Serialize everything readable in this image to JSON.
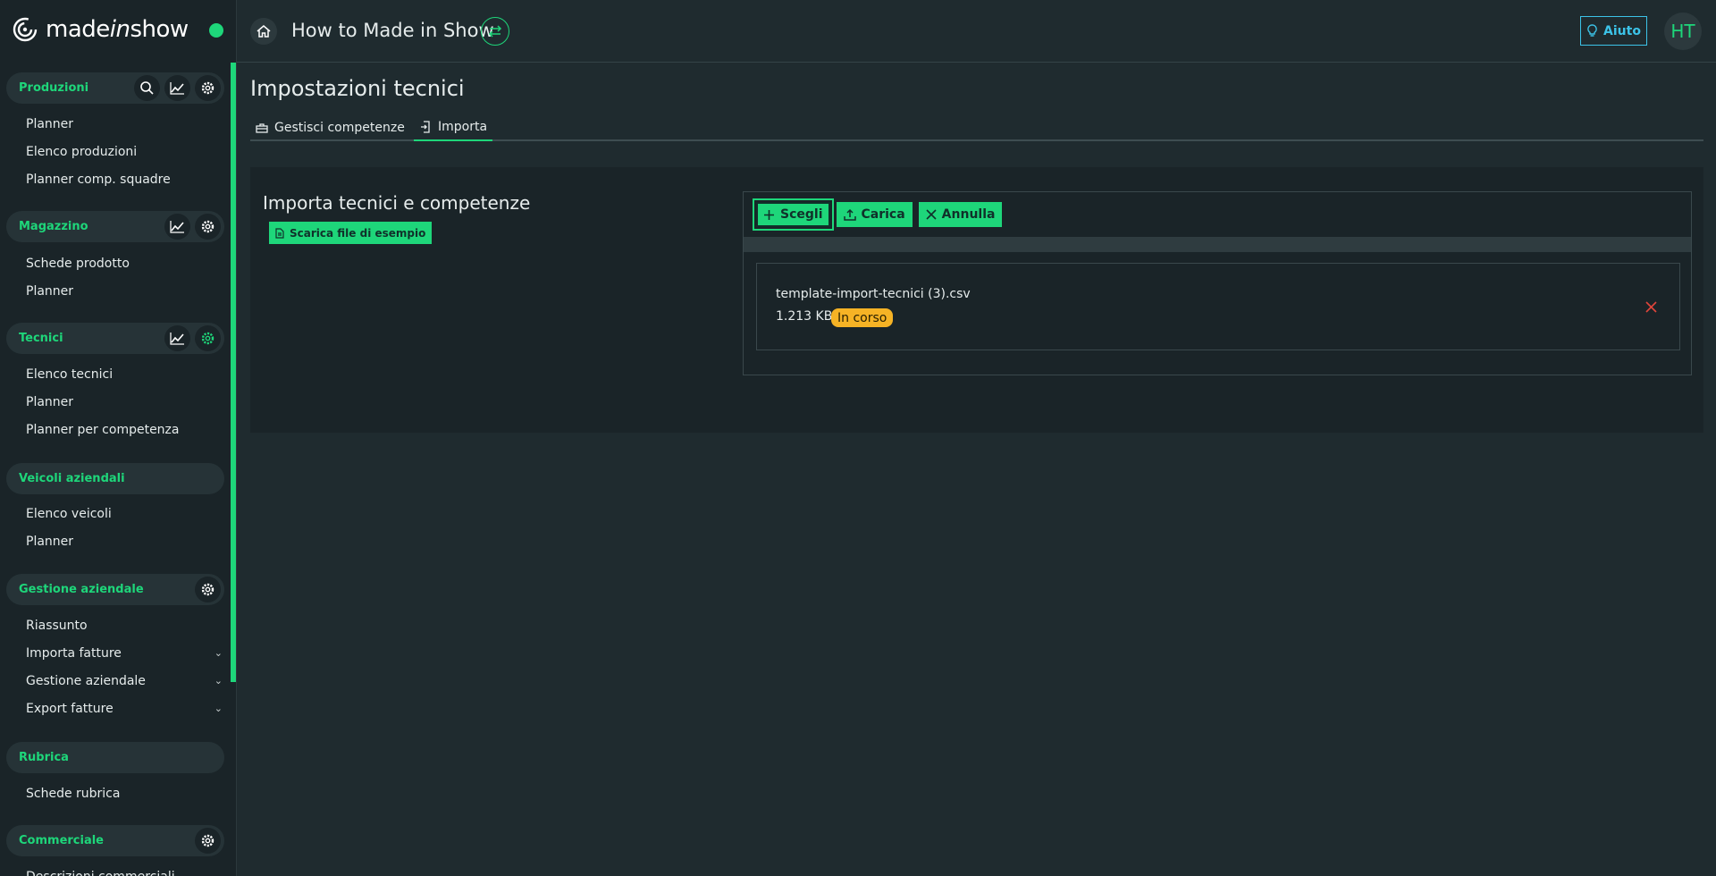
{
  "brand": {
    "name_pre": "made",
    "name_it": "in",
    "name_post": "show"
  },
  "sidebar": {
    "sections": [
      {
        "title": "Produzioni",
        "icons": [
          "search-icon",
          "chart-icon",
          "gear-icon"
        ],
        "items": [
          "Planner",
          "Elenco produzioni",
          "Planner comp. squadre"
        ]
      },
      {
        "title": "Magazzino",
        "icons": [
          "chart-icon",
          "gear-icon"
        ],
        "items": [
          "Schede prodotto",
          "Planner"
        ]
      },
      {
        "title": "Tecnici",
        "icons": [
          "chart-icon",
          "gear-icon"
        ],
        "items": [
          "Elenco tecnici",
          "Planner",
          "Planner per competenza"
        ]
      },
      {
        "title": "Veicoli aziendali",
        "icons": [],
        "items": [
          "Elenco veicoli",
          "Planner"
        ]
      },
      {
        "title": "Gestione aziendale",
        "icons": [
          "gear-icon"
        ],
        "items": [
          "Riassunto",
          "Importa fatture",
          "Gestione aziendale",
          "Export fatture"
        ]
      },
      {
        "title": "Rubrica",
        "icons": [],
        "items": [
          "Schede rubrica"
        ]
      },
      {
        "title": "Commerciale",
        "icons": [
          "gear-icon"
        ],
        "items": [
          "Descrizioni commerciali"
        ]
      }
    ]
  },
  "topbar": {
    "org_name": "How to Made in Show",
    "help_label": "Aiuto",
    "avatar_initials": "HT"
  },
  "page": {
    "title": "Impostazioni tecnici",
    "tabs": [
      {
        "label": "Gestisci competenze"
      },
      {
        "label": "Importa"
      }
    ],
    "active_tab": "Importa"
  },
  "import_card": {
    "title": "Importa tecnici e competenze",
    "download_label": "Scarica file di esempio",
    "buttons": {
      "choose": "Scegli",
      "upload": "Carica",
      "cancel": "Annulla"
    },
    "file": {
      "name": "template-import-tecnici (3).csv",
      "size": "1.213 KB",
      "status": "In corso"
    }
  },
  "colors": {
    "accent": "#1ed67a",
    "help": "#3cc3e8",
    "badge": "#f6b325",
    "remove": "#e0453b"
  }
}
